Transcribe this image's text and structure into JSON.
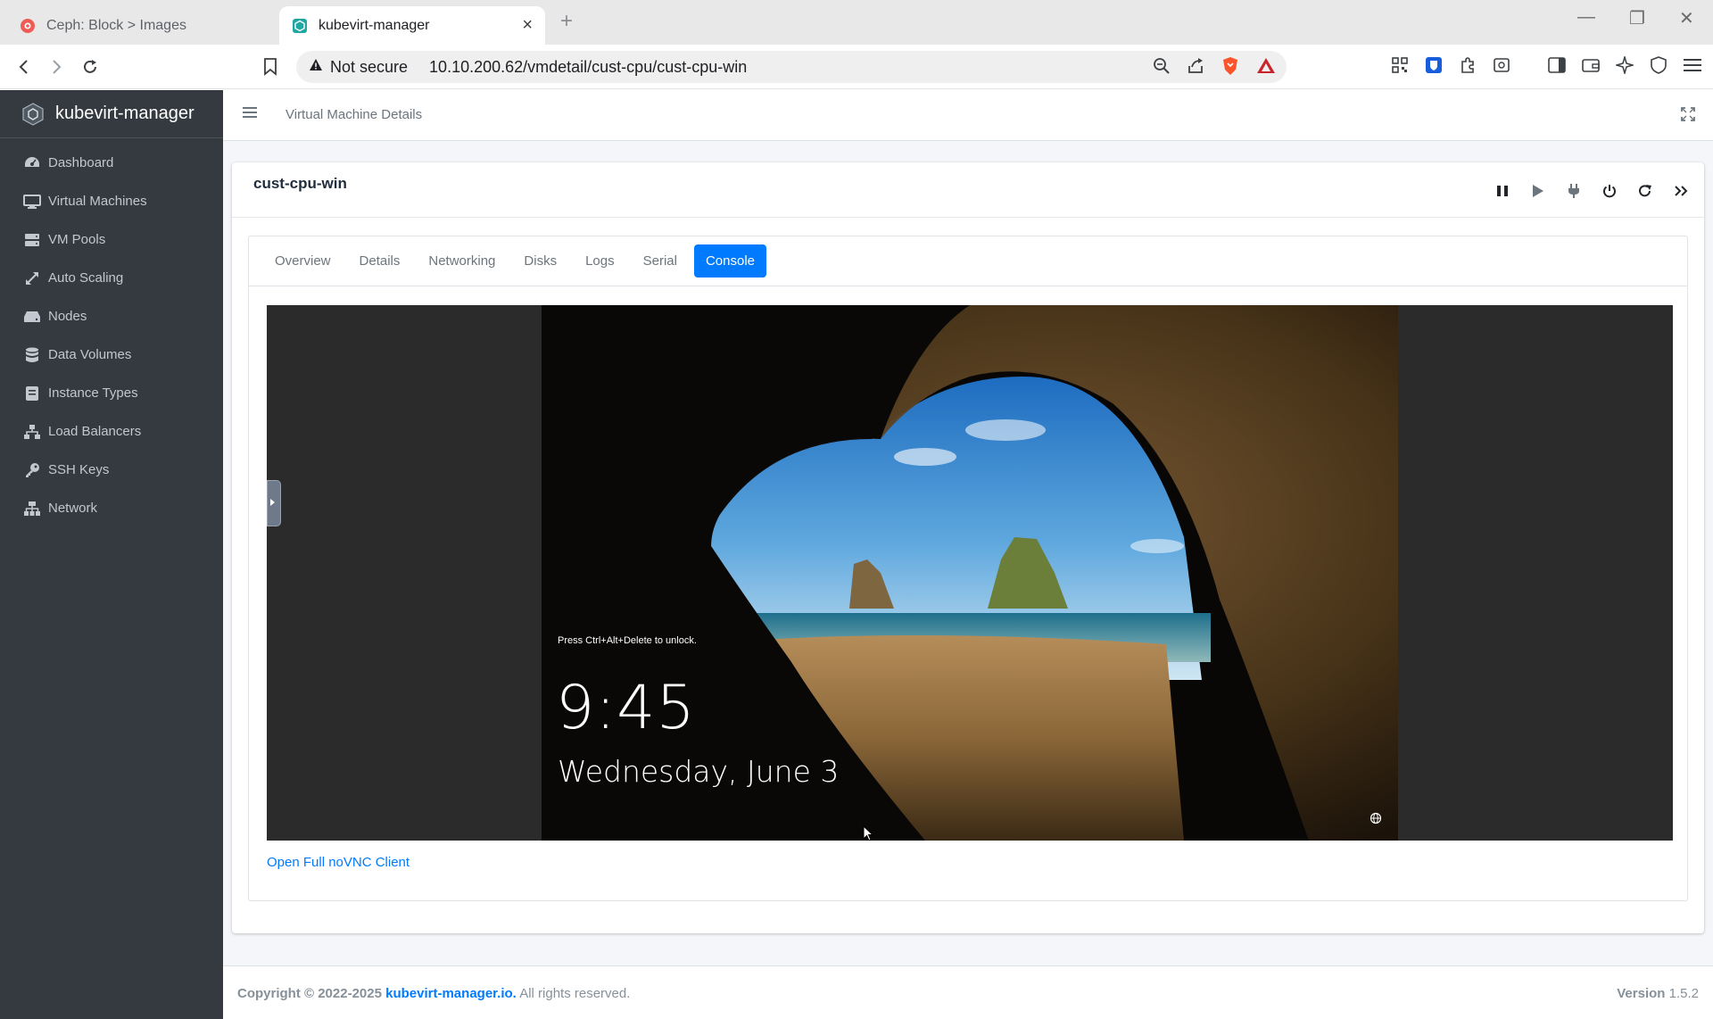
{
  "browser": {
    "tabs": [
      {
        "title": "Ceph: Block > Images",
        "active": false,
        "icon": "ceph-icon"
      },
      {
        "title": "kubevirt-manager",
        "active": true,
        "icon": "kubevirt-icon"
      }
    ],
    "security_label": "Not secure",
    "url": "10.10.200.62/vmdetail/cust-cpu/cust-cpu-win"
  },
  "sidebar": {
    "brand": "kubevirt-manager",
    "items": [
      {
        "label": "Dashboard",
        "icon": "dashboard-icon"
      },
      {
        "label": "Virtual Machines",
        "icon": "desktop-icon"
      },
      {
        "label": "VM Pools",
        "icon": "server-icon"
      },
      {
        "label": "Auto Scaling",
        "icon": "resize-icon"
      },
      {
        "label": "Nodes",
        "icon": "hdd-icon"
      },
      {
        "label": "Data Volumes",
        "icon": "database-icon"
      },
      {
        "label": "Instance Types",
        "icon": "list-icon"
      },
      {
        "label": "Load Balancers",
        "icon": "sitemap-icon"
      },
      {
        "label": "SSH Keys",
        "icon": "key-icon"
      },
      {
        "label": "Network",
        "icon": "network-icon"
      }
    ]
  },
  "topbar": {
    "breadcrumb": "Virtual Machine Details"
  },
  "vm": {
    "name": "cust-cpu-win",
    "actions": [
      "pause-icon",
      "play-icon",
      "plug-icon",
      "power-icon",
      "redo-icon",
      "forward-icon"
    ]
  },
  "tabs": [
    {
      "label": "Overview",
      "active": false
    },
    {
      "label": "Details",
      "active": false
    },
    {
      "label": "Networking",
      "active": false
    },
    {
      "label": "Disks",
      "active": false
    },
    {
      "label": "Logs",
      "active": false
    },
    {
      "label": "Serial",
      "active": false
    },
    {
      "label": "Console",
      "active": true
    }
  ],
  "console": {
    "hint": "Press Ctrl+Alt+Delete to unlock.",
    "time": "9:45",
    "date": "Wednesday, June 3",
    "link": "Open Full noVNC Client"
  },
  "footer": {
    "copyright_prefix": "Copyright © 2022-2025",
    "copyright_link": "kubevirt-manager.io.",
    "copyright_suffix": "All rights reserved.",
    "version_label": "Version",
    "version_value": "1.5.2"
  },
  "colors": {
    "sidebar_bg": "#343a40",
    "accent": "#007bff",
    "content_bg": "#f4f6f9"
  }
}
